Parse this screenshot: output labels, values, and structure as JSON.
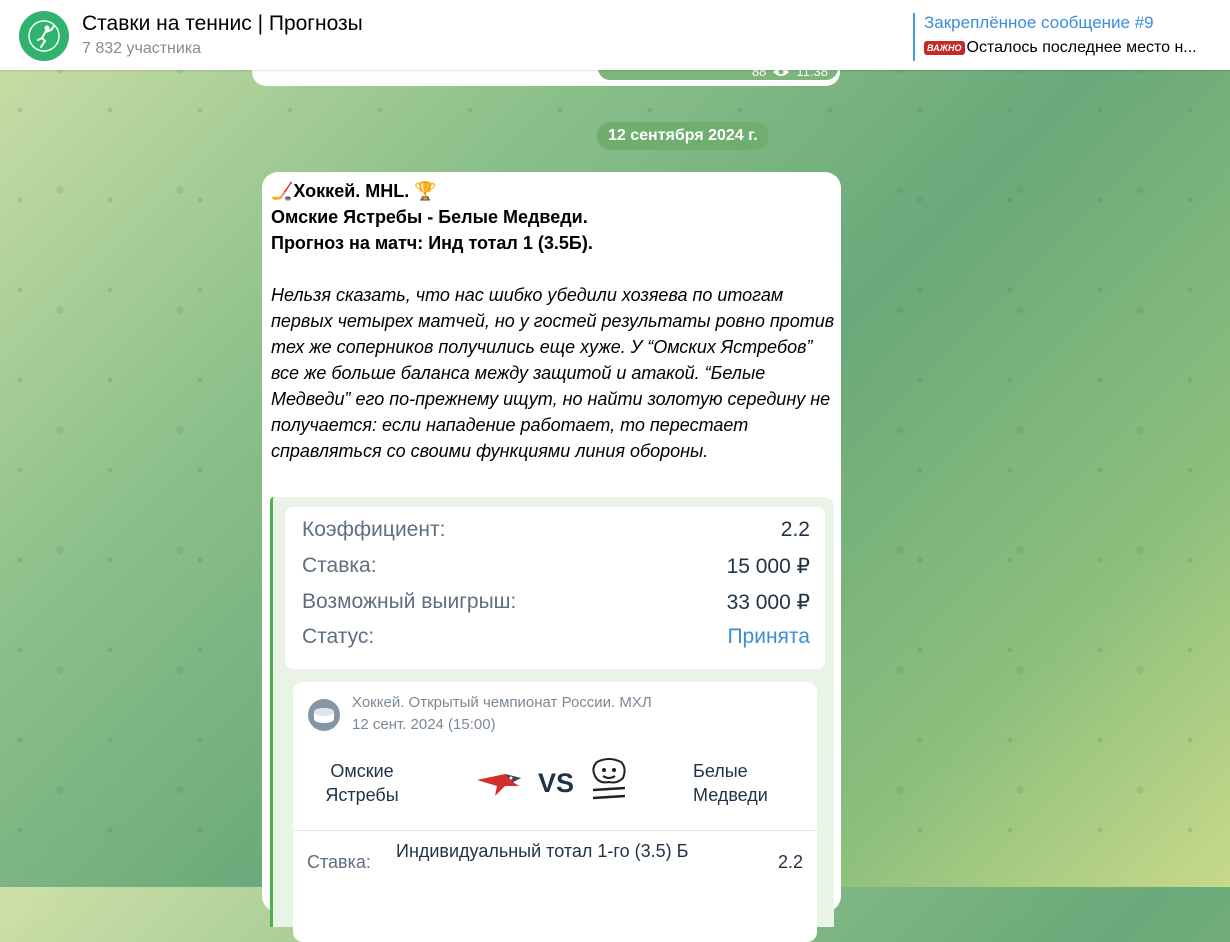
{
  "header": {
    "channel_title": "Ставки на теннис | Прогнозы",
    "members": "7 832 участника",
    "pinned_title": "Закреплённое сообщение #9",
    "pinned_badge": "ВАЖНО",
    "pinned_text": "Осталось последнее место н..."
  },
  "prev_message": {
    "views": "88",
    "time": "11:38"
  },
  "date_separator": "12 сентября 2024 г.",
  "message": {
    "line1": "🏒Хоккей. MHL. 🏆",
    "line2": "Омские Ястребы - Белые Медведи.",
    "line3": "Прогноз на матч: Инд тотал 1 (3.5Б).",
    "italic_text": "Нельзя сказать, что нас шибко убедили хозяева по итогам первых четырех матчей, но у гостей результаты ровно против тех же соперников получились еще хуже. У “Омских Ястребов” все же больше баланса между защитой и атакой. “Белые Медведи” его по-прежнему ищут, но найти золотую середину не получается: если нападение работает, то перестает справляться со своими функциями линия обороны."
  },
  "bet_card": {
    "rows": [
      {
        "label": "Коэффициент:",
        "value": "2.2"
      },
      {
        "label": "Ставка:",
        "value": "15 000 ₽"
      },
      {
        "label": "Возможный выигрыш:",
        "value": "33 000 ₽"
      },
      {
        "label": "Статус:",
        "value": "Принята"
      }
    ],
    "status_color": "#3b8fd0",
    "match": {
      "league": "Хоккей. Открытый чемпионат России. МХЛ",
      "date": "12 сент. 2024 (15:00)",
      "home_team": "Омские Ястребы",
      "away_team": "Белые Медведи",
      "vs": "VS",
      "bet_label": "Ставка:",
      "bet_desc": "Индивидуальный тотал 1-го (3.5) Б",
      "bet_odd": "2.2"
    }
  },
  "colors": {
    "accent": "#3a8fd9",
    "date_pill": "#6fae6f",
    "border_green": "#4caf50"
  }
}
